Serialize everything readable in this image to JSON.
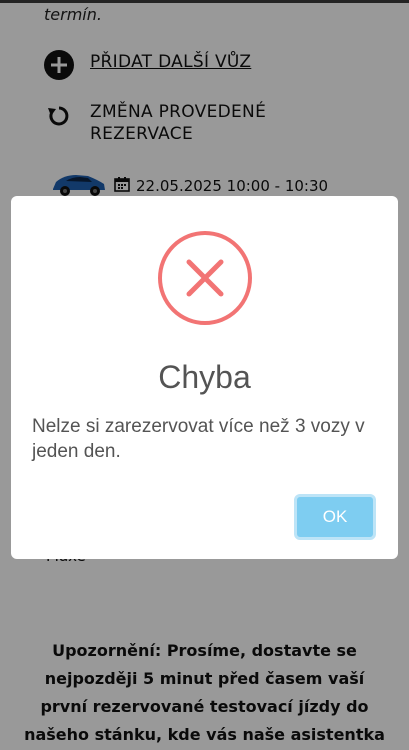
{
  "page": {
    "intro_text": "termín.",
    "add_car_label": "PŘIDAT DALŠÍ VŮZ",
    "change_reservation_line1": "ZMĚNA PROVEDENÉ",
    "change_reservation_line2": "REZERVACE",
    "reservation_datetime": "22.05.2025 10:00 - 10:30",
    "partial_text": "Maxe",
    "notice_text": "Upozornění: Prosíme, dostavte se nejpozději 5 minut před časem vaší první rezervované testovací jízdy do našeho stánku, kde vás naše asistentka"
  },
  "modal": {
    "icon": "error-x-icon",
    "title": "Chyba",
    "message": "Nelze si zarezervovat více než 3 vozy v jeden den.",
    "ok_label": "OK"
  },
  "colors": {
    "error_red": "#f27474",
    "ok_button": "#7ecdf1",
    "overlay": "rgba(0,0,0,0.4)"
  }
}
